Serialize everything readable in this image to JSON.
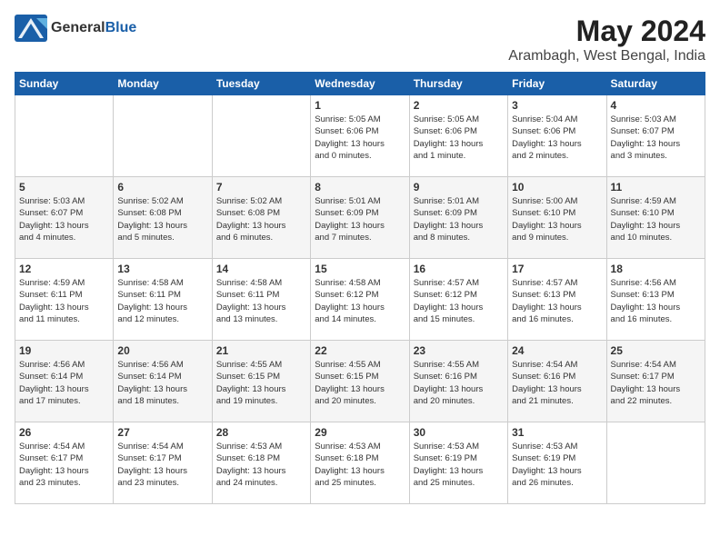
{
  "logo": {
    "general": "General",
    "blue": "Blue"
  },
  "title": {
    "month_year": "May 2024",
    "location": "Arambagh, West Bengal, India"
  },
  "days_of_week": [
    "Sunday",
    "Monday",
    "Tuesday",
    "Wednesday",
    "Thursday",
    "Friday",
    "Saturday"
  ],
  "weeks": [
    [
      {
        "day": "",
        "content": ""
      },
      {
        "day": "",
        "content": ""
      },
      {
        "day": "",
        "content": ""
      },
      {
        "day": "1",
        "content": "Sunrise: 5:05 AM\nSunset: 6:06 PM\nDaylight: 13 hours\nand 0 minutes."
      },
      {
        "day": "2",
        "content": "Sunrise: 5:05 AM\nSunset: 6:06 PM\nDaylight: 13 hours\nand 1 minute."
      },
      {
        "day": "3",
        "content": "Sunrise: 5:04 AM\nSunset: 6:06 PM\nDaylight: 13 hours\nand 2 minutes."
      },
      {
        "day": "4",
        "content": "Sunrise: 5:03 AM\nSunset: 6:07 PM\nDaylight: 13 hours\nand 3 minutes."
      }
    ],
    [
      {
        "day": "5",
        "content": "Sunrise: 5:03 AM\nSunset: 6:07 PM\nDaylight: 13 hours\nand 4 minutes."
      },
      {
        "day": "6",
        "content": "Sunrise: 5:02 AM\nSunset: 6:08 PM\nDaylight: 13 hours\nand 5 minutes."
      },
      {
        "day": "7",
        "content": "Sunrise: 5:02 AM\nSunset: 6:08 PM\nDaylight: 13 hours\nand 6 minutes."
      },
      {
        "day": "8",
        "content": "Sunrise: 5:01 AM\nSunset: 6:09 PM\nDaylight: 13 hours\nand 7 minutes."
      },
      {
        "day": "9",
        "content": "Sunrise: 5:01 AM\nSunset: 6:09 PM\nDaylight: 13 hours\nand 8 minutes."
      },
      {
        "day": "10",
        "content": "Sunrise: 5:00 AM\nSunset: 6:10 PM\nDaylight: 13 hours\nand 9 minutes."
      },
      {
        "day": "11",
        "content": "Sunrise: 4:59 AM\nSunset: 6:10 PM\nDaylight: 13 hours\nand 10 minutes."
      }
    ],
    [
      {
        "day": "12",
        "content": "Sunrise: 4:59 AM\nSunset: 6:11 PM\nDaylight: 13 hours\nand 11 minutes."
      },
      {
        "day": "13",
        "content": "Sunrise: 4:58 AM\nSunset: 6:11 PM\nDaylight: 13 hours\nand 12 minutes."
      },
      {
        "day": "14",
        "content": "Sunrise: 4:58 AM\nSunset: 6:11 PM\nDaylight: 13 hours\nand 13 minutes."
      },
      {
        "day": "15",
        "content": "Sunrise: 4:58 AM\nSunset: 6:12 PM\nDaylight: 13 hours\nand 14 minutes."
      },
      {
        "day": "16",
        "content": "Sunrise: 4:57 AM\nSunset: 6:12 PM\nDaylight: 13 hours\nand 15 minutes."
      },
      {
        "day": "17",
        "content": "Sunrise: 4:57 AM\nSunset: 6:13 PM\nDaylight: 13 hours\nand 16 minutes."
      },
      {
        "day": "18",
        "content": "Sunrise: 4:56 AM\nSunset: 6:13 PM\nDaylight: 13 hours\nand 16 minutes."
      }
    ],
    [
      {
        "day": "19",
        "content": "Sunrise: 4:56 AM\nSunset: 6:14 PM\nDaylight: 13 hours\nand 17 minutes."
      },
      {
        "day": "20",
        "content": "Sunrise: 4:56 AM\nSunset: 6:14 PM\nDaylight: 13 hours\nand 18 minutes."
      },
      {
        "day": "21",
        "content": "Sunrise: 4:55 AM\nSunset: 6:15 PM\nDaylight: 13 hours\nand 19 minutes."
      },
      {
        "day": "22",
        "content": "Sunrise: 4:55 AM\nSunset: 6:15 PM\nDaylight: 13 hours\nand 20 minutes."
      },
      {
        "day": "23",
        "content": "Sunrise: 4:55 AM\nSunset: 6:16 PM\nDaylight: 13 hours\nand 20 minutes."
      },
      {
        "day": "24",
        "content": "Sunrise: 4:54 AM\nSunset: 6:16 PM\nDaylight: 13 hours\nand 21 minutes."
      },
      {
        "day": "25",
        "content": "Sunrise: 4:54 AM\nSunset: 6:17 PM\nDaylight: 13 hours\nand 22 minutes."
      }
    ],
    [
      {
        "day": "26",
        "content": "Sunrise: 4:54 AM\nSunset: 6:17 PM\nDaylight: 13 hours\nand 23 minutes."
      },
      {
        "day": "27",
        "content": "Sunrise: 4:54 AM\nSunset: 6:17 PM\nDaylight: 13 hours\nand 23 minutes."
      },
      {
        "day": "28",
        "content": "Sunrise: 4:53 AM\nSunset: 6:18 PM\nDaylight: 13 hours\nand 24 minutes."
      },
      {
        "day": "29",
        "content": "Sunrise: 4:53 AM\nSunset: 6:18 PM\nDaylight: 13 hours\nand 25 minutes."
      },
      {
        "day": "30",
        "content": "Sunrise: 4:53 AM\nSunset: 6:19 PM\nDaylight: 13 hours\nand 25 minutes."
      },
      {
        "day": "31",
        "content": "Sunrise: 4:53 AM\nSunset: 6:19 PM\nDaylight: 13 hours\nand 26 minutes."
      },
      {
        "day": "",
        "content": ""
      }
    ]
  ]
}
